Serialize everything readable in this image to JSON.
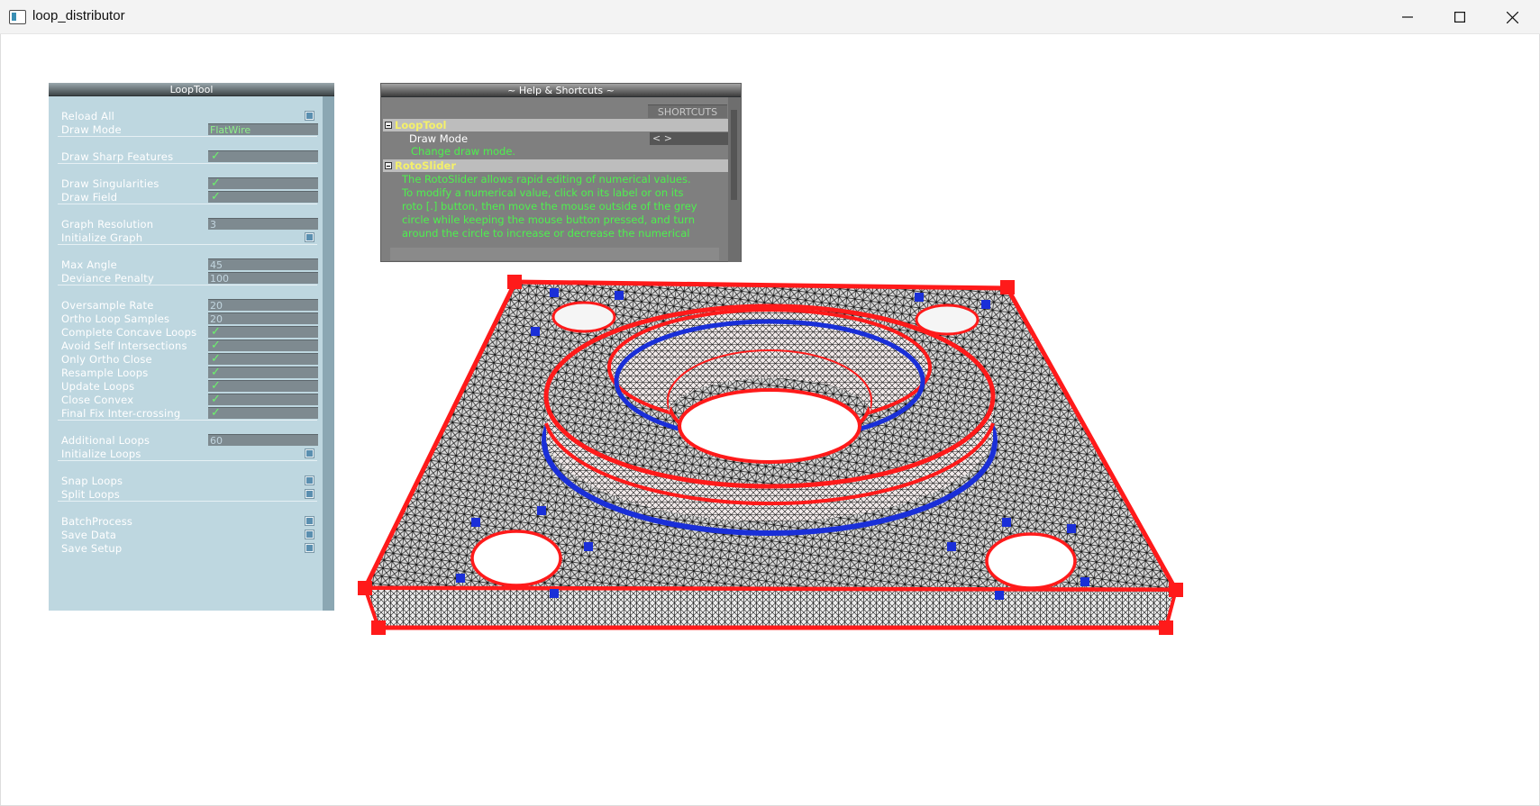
{
  "window": {
    "title": "loop_distributor",
    "controls": {
      "minimize": "minimize",
      "maximize": "maximize",
      "close": "close"
    }
  },
  "looptool": {
    "title": "LoopTool",
    "rows": [
      {
        "label": "Reload All",
        "kind": "button"
      },
      {
        "label": "Draw Mode",
        "kind": "value",
        "value": "FlatWire",
        "green": true
      },
      {
        "label": "Draw Sharp Features",
        "kind": "check"
      },
      {
        "label": "Draw Singularities",
        "kind": "check"
      },
      {
        "label": "Draw Field",
        "kind": "check"
      },
      {
        "label": "Graph Resolution",
        "kind": "value",
        "value": "3"
      },
      {
        "label": "Initialize Graph",
        "kind": "button"
      },
      {
        "label": "Max Angle",
        "kind": "value",
        "value": "45"
      },
      {
        "label": "Deviance Penalty",
        "kind": "value",
        "value": "100"
      },
      {
        "label": "Oversample Rate",
        "kind": "value",
        "value": "20"
      },
      {
        "label": "Ortho Loop Samples",
        "kind": "value",
        "value": "20"
      },
      {
        "label": "Complete Concave Loops",
        "kind": "check"
      },
      {
        "label": "Avoid Self Intersections",
        "kind": "check"
      },
      {
        "label": "Only Ortho Close",
        "kind": "check"
      },
      {
        "label": "Resample Loops",
        "kind": "check"
      },
      {
        "label": "Update Loops",
        "kind": "check"
      },
      {
        "label": "Close Convex",
        "kind": "check"
      },
      {
        "label": "Final Fix Inter-crossing",
        "kind": "check"
      },
      {
        "label": "Additional Loops",
        "kind": "value",
        "value": "60"
      },
      {
        "label": "Initialize Loops",
        "kind": "button"
      },
      {
        "label": "Snap Loops",
        "kind": "button"
      },
      {
        "label": "Split Loops",
        "kind": "button"
      },
      {
        "label": "BatchProcess",
        "kind": "button"
      },
      {
        "label": "Save Data",
        "kind": "button"
      },
      {
        "label": "Save Setup",
        "kind": "button"
      }
    ],
    "check_mark": "✓"
  },
  "help": {
    "title": "~ Help & Shortcuts ~",
    "shortcuts_header": "SHORTCUTS",
    "sections": [
      {
        "name": "LoopTool",
        "items": [
          {
            "label": "Draw Mode",
            "key": "< >",
            "desc": "Change draw mode."
          }
        ]
      },
      {
        "name": "RotoSlider",
        "desc_lines": [
          "The RotoSlider allows rapid editing of numerical values.",
          "To modify a numerical value, click on its label or on its",
          "roto [.] button, then move the mouse outside of the grey",
          "circle while keeping the mouse button pressed, and turn",
          "around the circle to increase or decrease the numerical"
        ]
      }
    ]
  },
  "colors": {
    "loop_red": "#ff1a1a",
    "loop_blue": "#1a2fd8",
    "mesh_dark": "#141414",
    "mesh_light": "#e8e8e8",
    "check_green": "#6cf26c",
    "help_green": "#4ef04e",
    "section_yellow": "#f4f06a"
  }
}
